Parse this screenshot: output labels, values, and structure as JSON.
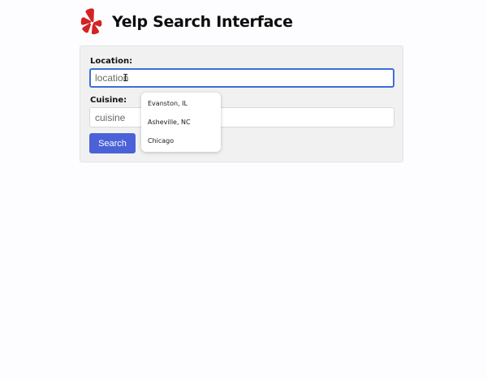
{
  "header": {
    "title": "Yelp Search Interface",
    "logo_icon": "yelp-burst-icon",
    "logo_color": "#d32323"
  },
  "form": {
    "location_label": "Location:",
    "location_placeholder": "location",
    "location_value": "",
    "cuisine_label": "Cuisine:",
    "cuisine_placeholder": "cuisine",
    "cuisine_value": "",
    "search_label": "Search",
    "search_color": "#4b61d8",
    "focus_color": "#3d6fd6"
  },
  "dropdown": {
    "options": [
      "Evanston, IL",
      "Asheville, NC",
      "Chicago"
    ]
  },
  "cursor_icon": "text-cursor-icon"
}
